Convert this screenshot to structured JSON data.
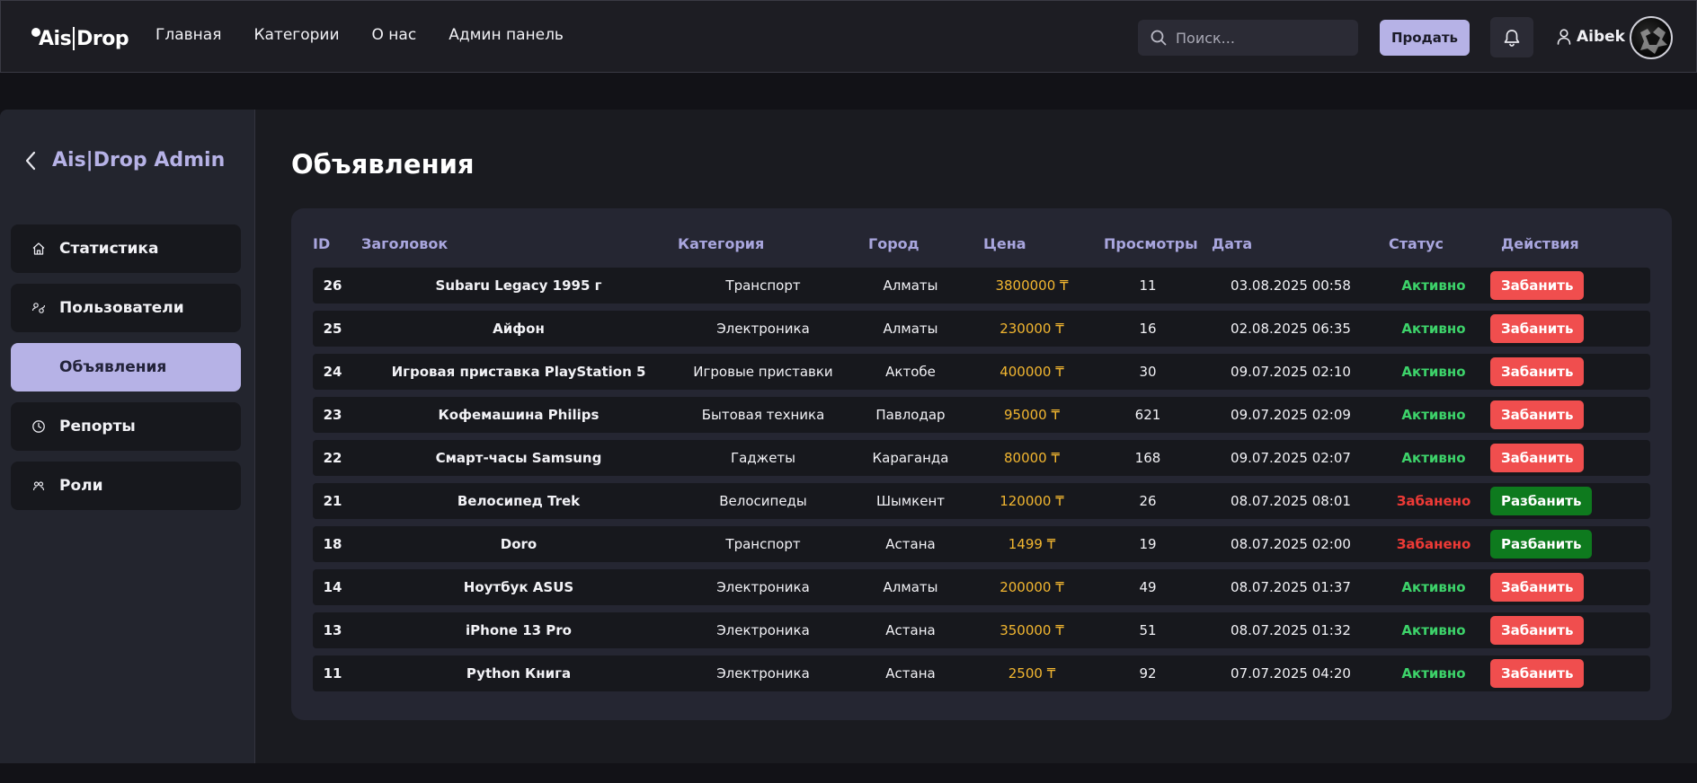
{
  "brand": {
    "left": "Ais",
    "right": "Drop"
  },
  "nav": [
    "Главная",
    "Категории",
    "О нас",
    "Админ панель"
  ],
  "search": {
    "placeholder": "Поиск..."
  },
  "sell_label": "Продать",
  "user": {
    "name": "Aibek"
  },
  "sidebar": {
    "title": "Ais|Drop Admin",
    "items": [
      {
        "label": "Статистика",
        "icon": "home-icon",
        "active": false
      },
      {
        "label": "Пользователи",
        "icon": "users-icon",
        "active": false
      },
      {
        "label": "Объявления",
        "icon": "",
        "active": true
      },
      {
        "label": "Репорты",
        "icon": "clock-icon",
        "active": false
      },
      {
        "label": "Роли",
        "icon": "roles-icon",
        "active": false
      }
    ]
  },
  "page_title": "Объявления",
  "table": {
    "headers": [
      "ID",
      "Заголовок",
      "Категория",
      "Город",
      "Цена",
      "Просмотры",
      "Дата",
      "Статус",
      "Действия"
    ],
    "rows": [
      {
        "id": "26",
        "title": "Subaru Legacy 1995 г",
        "category": "Транспорт",
        "city": "Алматы",
        "price": "3800000 ₸",
        "views": "11",
        "date": "03.08.2025 00:58",
        "status": "Активно",
        "action": "Забанить"
      },
      {
        "id": "25",
        "title": "Айфон",
        "category": "Электроника",
        "city": "Алматы",
        "price": "230000 ₸",
        "views": "16",
        "date": "02.08.2025 06:35",
        "status": "Активно",
        "action": "Забанить"
      },
      {
        "id": "24",
        "title": "Игровая приставка PlayStation 5",
        "category": "Игровые приставки",
        "city": "Актобе",
        "price": "400000 ₸",
        "views": "30",
        "date": "09.07.2025 02:10",
        "status": "Активно",
        "action": "Забанить"
      },
      {
        "id": "23",
        "title": "Кофемашина Philips",
        "category": "Бытовая техника",
        "city": "Павлодар",
        "price": "95000 ₸",
        "views": "621",
        "date": "09.07.2025 02:09",
        "status": "Активно",
        "action": "Забанить"
      },
      {
        "id": "22",
        "title": "Смарт-часы Samsung",
        "category": "Гаджеты",
        "city": "Караганда",
        "price": "80000 ₸",
        "views": "168",
        "date": "09.07.2025 02:07",
        "status": "Активно",
        "action": "Забанить"
      },
      {
        "id": "21",
        "title": "Велосипед Trek",
        "category": "Велосипеды",
        "city": "Шымкент",
        "price": "120000 ₸",
        "views": "26",
        "date": "08.07.2025 08:01",
        "status": "Забанено",
        "action": "Разбанить"
      },
      {
        "id": "18",
        "title": "Doro",
        "category": "Транспорт",
        "city": "Астана",
        "price": "1499 ₸",
        "views": "19",
        "date": "08.07.2025 02:00",
        "status": "Забанено",
        "action": "Разбанить"
      },
      {
        "id": "14",
        "title": "Ноутбук ASUS",
        "category": "Электроника",
        "city": "Алматы",
        "price": "200000 ₸",
        "views": "49",
        "date": "08.07.2025 01:37",
        "status": "Активно",
        "action": "Забанить"
      },
      {
        "id": "13",
        "title": "iPhone 13 Pro",
        "category": "Электроника",
        "city": "Астана",
        "price": "350000 ₸",
        "views": "51",
        "date": "08.07.2025 01:32",
        "status": "Активно",
        "action": "Забанить"
      },
      {
        "id": "11",
        "title": "Python Книга",
        "category": "Электроника",
        "city": "Астана",
        "price": "2500 ₸",
        "views": "92",
        "date": "07.07.2025 04:20",
        "status": "Активно",
        "action": "Забанить"
      }
    ]
  },
  "colors": {
    "accent": "#b6b2e6",
    "active_status": "#3dd36a",
    "banned_status": "#ee3a36",
    "price": "#f2b630",
    "ban_button": "#f04e4e",
    "unban_button": "#0e7a1e"
  }
}
